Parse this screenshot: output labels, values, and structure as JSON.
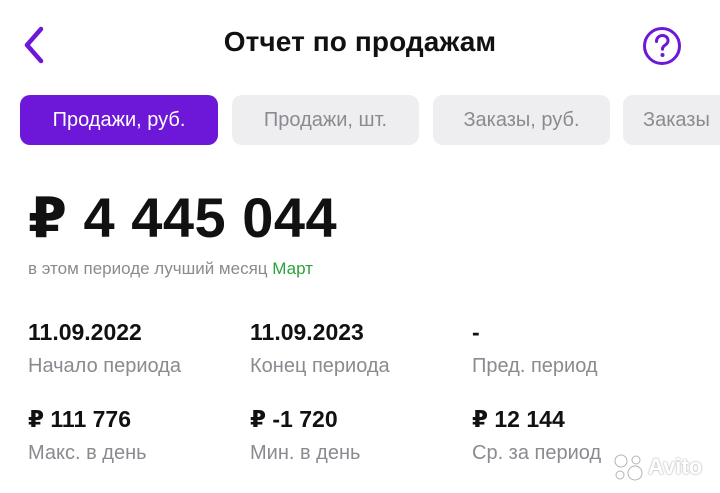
{
  "header": {
    "title": "Отчет по продажам",
    "back_icon": "chevron-left-icon",
    "help_icon": "question-circle-icon",
    "accent_color": "#6d17d8"
  },
  "tabs": [
    {
      "label": "Продажи, руб.",
      "active": true
    },
    {
      "label": "Продажи, шт.",
      "active": false
    },
    {
      "label": "Заказы, руб.",
      "active": false
    },
    {
      "label": "Заказы",
      "active": false
    }
  ],
  "summary": {
    "total": "₽ 4 445 044",
    "period_text": "в этом периоде лучший месяц",
    "best_month": "Март",
    "best_month_color": "#2aa33a"
  },
  "stats": [
    {
      "value": "11.09.2022",
      "label": "Начало периода"
    },
    {
      "value": "11.09.2023",
      "label": "Конец периода"
    },
    {
      "value": "-",
      "label": "Пред. период"
    },
    {
      "value": "₽ 111 776",
      "label": "Макс. в день"
    },
    {
      "value": "₽ -1 720",
      "label": "Мин. в день"
    },
    {
      "value": "₽ 12 144",
      "label": "Ср. за период"
    }
  ],
  "watermark": {
    "text": "Avito"
  }
}
